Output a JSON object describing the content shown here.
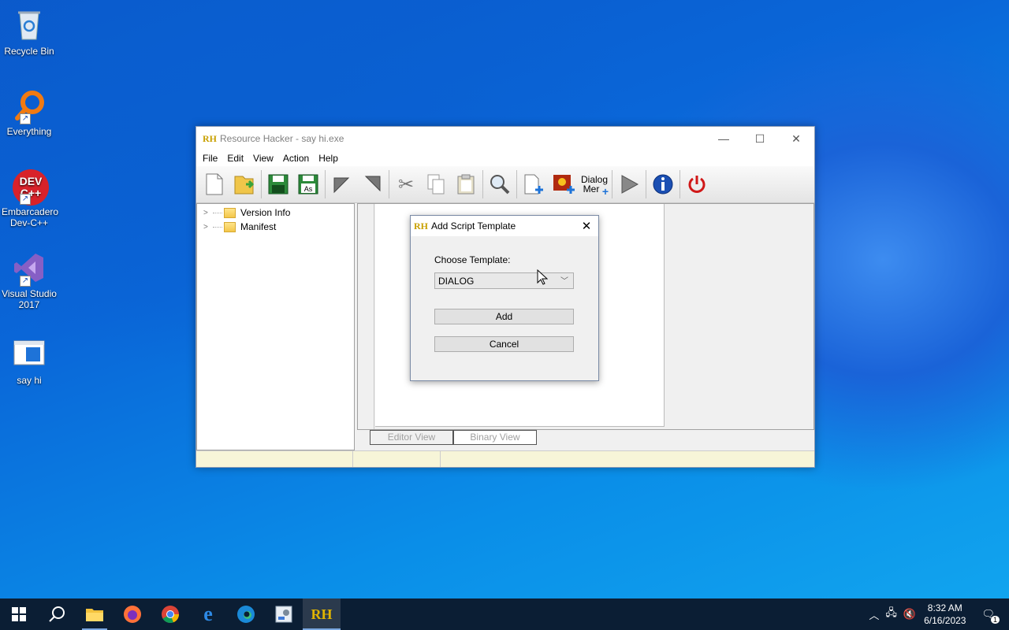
{
  "desktop": {
    "icons": [
      {
        "label": "Recycle Bin",
        "icon": "recycle-bin-icon"
      },
      {
        "label": "Everything",
        "icon": "everything-search-icon"
      },
      {
        "label": "Embarcadero Dev-C++",
        "icon": "devcpp-icon",
        "badge": "DEV C++"
      },
      {
        "label": "Visual Studio 2017",
        "icon": "visual-studio-icon"
      },
      {
        "label": "say hi",
        "icon": "exe-file-icon"
      }
    ]
  },
  "window": {
    "title": "Resource Hacker - say hi.exe",
    "app_icon_text": "RH",
    "menu": [
      "File",
      "Edit",
      "View",
      "Action",
      "Help"
    ],
    "toolbar": {
      "dialog_merge_label_1": "Dialog",
      "dialog_merge_label_2": "Mer"
    },
    "tree": [
      {
        "label": "Version Info"
      },
      {
        "label": "Manifest"
      }
    ],
    "tabs": {
      "editor": "Editor View",
      "binary": "Binary View"
    }
  },
  "dialog": {
    "title": "Add Script Template",
    "label": "Choose Template:",
    "selected": "DIALOG",
    "add_label": "Add",
    "cancel_label": "Cancel"
  },
  "taskbar": {
    "time": "8:32 AM",
    "date": "6/16/2023",
    "notifications": "1",
    "rh_label": "RH"
  },
  "colors": {
    "accent": "#0a66d8",
    "taskbar": "#0b1e34"
  }
}
